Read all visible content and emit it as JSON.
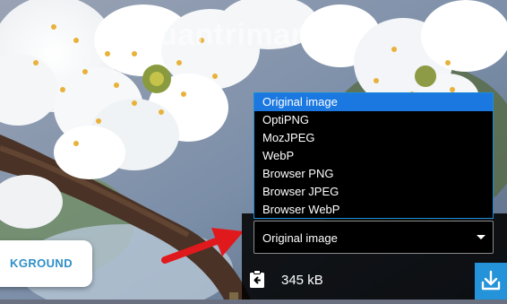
{
  "watermark": "Quantrimang",
  "left_button": {
    "label": "KGROUND"
  },
  "method_dropdown": {
    "options": [
      "Original image",
      "OptiPNG",
      "MozJPEG",
      "WebP",
      "Browser PNG",
      "Browser JPEG",
      "Browser WebP"
    ],
    "highlighted_index": 0,
    "selected": "Original image"
  },
  "status": {
    "size": "345 kB"
  },
  "icons": {
    "clipboard": "clipboard-back-arrow-icon",
    "download": "download-icon",
    "arrow": "red-arrow-annotation"
  },
  "colors": {
    "accent": "#2493d9",
    "highlight": "#1b78e0",
    "arrow": "#e0191c"
  }
}
